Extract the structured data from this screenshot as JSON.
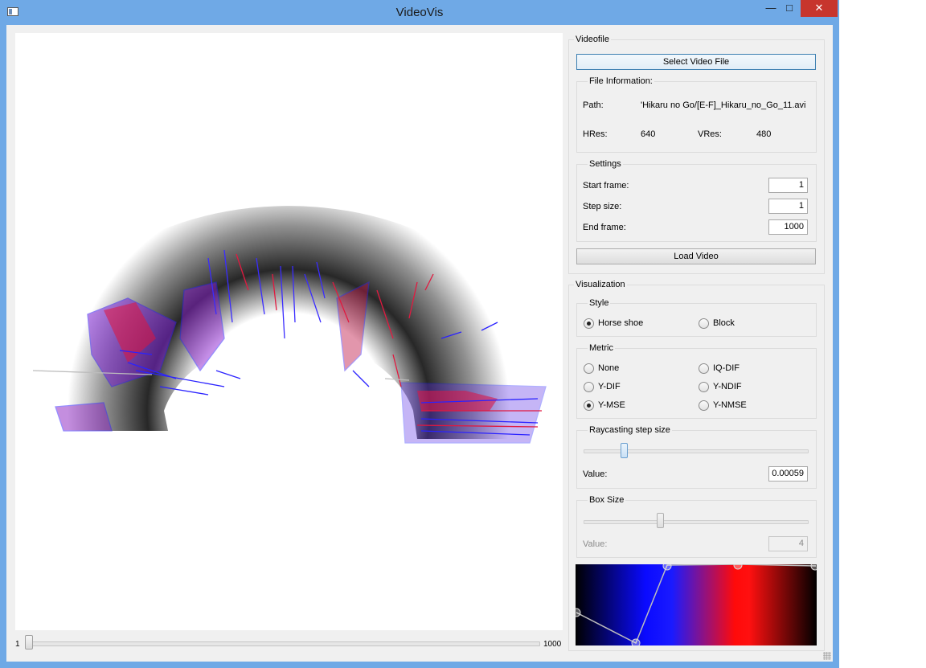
{
  "window": {
    "title": "VideoVis"
  },
  "frame_slider": {
    "min_label": "1",
    "max_label": "1000",
    "value": 1,
    "min": 1,
    "max": 1000
  },
  "videofile": {
    "group_title": "Videofile",
    "select_button": "Select Video File",
    "file_info": {
      "group_title": "File Information:",
      "path_label": "Path:",
      "path_value": "'Hikaru no Go/[E-F]_Hikaru_no_Go_11.avi",
      "hres_label": "HRes:",
      "hres_value": "640",
      "vres_label": "VRes:",
      "vres_value": "480"
    },
    "settings": {
      "group_title": "Settings",
      "start_label": "Start frame:",
      "start_value": "1",
      "step_label": "Step size:",
      "step_value": "1",
      "end_label": "End frame:",
      "end_value": "1000"
    },
    "load_button": "Load Video"
  },
  "visualization": {
    "group_title": "Visualization",
    "style": {
      "group_title": "Style",
      "options": [
        {
          "label": "Horse shoe",
          "checked": true
        },
        {
          "label": "Block",
          "checked": false
        }
      ]
    },
    "metric": {
      "group_title": "Metric",
      "options": [
        {
          "label": "None",
          "checked": false
        },
        {
          "label": "IQ-DIF",
          "checked": false
        },
        {
          "label": "Y-DIF",
          "checked": false
        },
        {
          "label": "Y-NDIF",
          "checked": false
        },
        {
          "label": "Y-MSE",
          "checked": true
        },
        {
          "label": "Y-NMSE",
          "checked": false
        }
      ]
    },
    "raycasting": {
      "group_title": "Raycasting step size",
      "value_label": "Value:",
      "value": "0.00059",
      "slider_fraction": 0.17
    },
    "box_size": {
      "group_title": "Box Size",
      "value_label": "Value:",
      "value": "4",
      "slider_fraction": 0.34
    },
    "transfer_function": {
      "colors": [
        "#000000",
        "#0a0aff",
        "#1a1aff",
        "#ff0a0a",
        "#ff1010",
        "#000000"
      ]
    }
  }
}
